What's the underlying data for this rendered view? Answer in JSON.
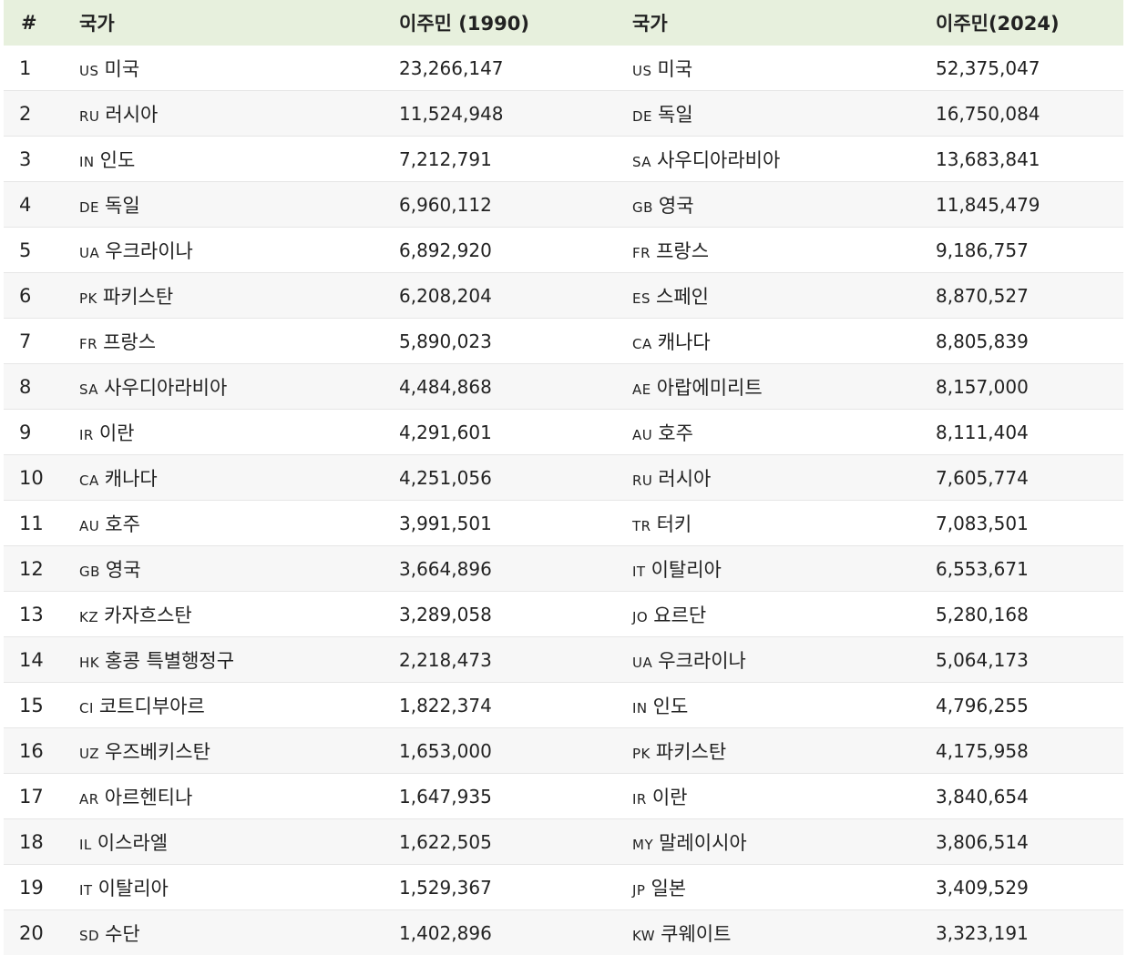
{
  "table": {
    "headers": {
      "rank": "#",
      "country_1990": "국가",
      "immigrants_1990": "이주민 (1990)",
      "country_2024": "국가",
      "immigrants_2024": "이주민(2024)"
    },
    "rows": [
      {
        "rank": "1",
        "c1_code": "US",
        "c1_name": "미국",
        "v1": "23,266,147",
        "c2_code": "US",
        "c2_name": "미국",
        "v2": "52,375,047"
      },
      {
        "rank": "2",
        "c1_code": "RU",
        "c1_name": "러시아",
        "v1": "11,524,948",
        "c2_code": "DE",
        "c2_name": "독일",
        "v2": "16,750,084"
      },
      {
        "rank": "3",
        "c1_code": "IN",
        "c1_name": "인도",
        "v1": "7,212,791",
        "c2_code": "SA",
        "c2_name": "사우디아라비아",
        "v2": "13,683,841"
      },
      {
        "rank": "4",
        "c1_code": "DE",
        "c1_name": "독일",
        "v1": "6,960,112",
        "c2_code": "GB",
        "c2_name": "영국",
        "v2": "11,845,479"
      },
      {
        "rank": "5",
        "c1_code": "UA",
        "c1_name": "우크라이나",
        "v1": "6,892,920",
        "c2_code": "FR",
        "c2_name": "프랑스",
        "v2": "9,186,757"
      },
      {
        "rank": "6",
        "c1_code": "PK",
        "c1_name": "파키스탄",
        "v1": "6,208,204",
        "c2_code": "ES",
        "c2_name": "스페인",
        "v2": "8,870,527"
      },
      {
        "rank": "7",
        "c1_code": "FR",
        "c1_name": "프랑스",
        "v1": "5,890,023",
        "c2_code": "CA",
        "c2_name": "캐나다",
        "v2": "8,805,839"
      },
      {
        "rank": "8",
        "c1_code": "SA",
        "c1_name": "사우디아라비아",
        "v1": "4,484,868",
        "c2_code": "AE",
        "c2_name": "아랍에미리트",
        "v2": "8,157,000"
      },
      {
        "rank": "9",
        "c1_code": "IR",
        "c1_name": "이란",
        "v1": "4,291,601",
        "c2_code": "AU",
        "c2_name": "호주",
        "v2": "8,111,404"
      },
      {
        "rank": "10",
        "c1_code": "CA",
        "c1_name": "캐나다",
        "v1": "4,251,056",
        "c2_code": "RU",
        "c2_name": "러시아",
        "v2": "7,605,774"
      },
      {
        "rank": "11",
        "c1_code": "AU",
        "c1_name": "호주",
        "v1": "3,991,501",
        "c2_code": "TR",
        "c2_name": "터키",
        "v2": "7,083,501"
      },
      {
        "rank": "12",
        "c1_code": "GB",
        "c1_name": "영국",
        "v1": "3,664,896",
        "c2_code": "IT",
        "c2_name": "이탈리아",
        "v2": "6,553,671"
      },
      {
        "rank": "13",
        "c1_code": "KZ",
        "c1_name": "카자흐스탄",
        "v1": "3,289,058",
        "c2_code": "JO",
        "c2_name": "요르단",
        "v2": "5,280,168"
      },
      {
        "rank": "14",
        "c1_code": "HK",
        "c1_name": "홍콩 특별행정구",
        "v1": "2,218,473",
        "c2_code": "UA",
        "c2_name": "우크라이나",
        "v2": "5,064,173"
      },
      {
        "rank": "15",
        "c1_code": "CI",
        "c1_name": "코트디부아르",
        "v1": "1,822,374",
        "c2_code": "IN",
        "c2_name": "인도",
        "v2": "4,796,255"
      },
      {
        "rank": "16",
        "c1_code": "UZ",
        "c1_name": "우즈베키스탄",
        "v1": "1,653,000",
        "c2_code": "PK",
        "c2_name": "파키스탄",
        "v2": "4,175,958"
      },
      {
        "rank": "17",
        "c1_code": "AR",
        "c1_name": "아르헨티나",
        "v1": "1,647,935",
        "c2_code": "IR",
        "c2_name": "이란",
        "v2": "3,840,654"
      },
      {
        "rank": "18",
        "c1_code": "IL",
        "c1_name": "이스라엘",
        "v1": "1,622,505",
        "c2_code": "MY",
        "c2_name": "말레이시아",
        "v2": "3,806,514"
      },
      {
        "rank": "19",
        "c1_code": "IT",
        "c1_name": "이탈리아",
        "v1": "1,529,367",
        "c2_code": "JP",
        "c2_name": "일본",
        "v2": "3,409,529"
      },
      {
        "rank": "20",
        "c1_code": "SD",
        "c1_name": "수단",
        "v1": "1,402,896",
        "c2_code": "KW",
        "c2_name": "쿠웨이트",
        "v2": "3,323,191"
      }
    ]
  },
  "colors": {
    "header_bg": "#e7f0dd",
    "stripe_bg": "#f7f7f7",
    "text": "#222222"
  }
}
